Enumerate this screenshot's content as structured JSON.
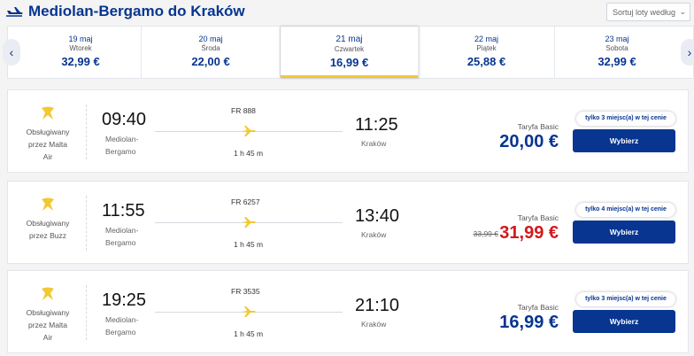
{
  "header": {
    "title": "Mediolan-Bergamo do Kraków",
    "sort_label": "Sortuj loty według",
    "icons": {
      "plane": "plane-icon",
      "sort": "chevron-down-icon"
    }
  },
  "date_strip": {
    "prev_icon": "chevron-left-icon",
    "next_icon": "chevron-right-icon",
    "days": [
      {
        "date": "19 maj",
        "weekday": "Wtorek",
        "price": "32,99 €"
      },
      {
        "date": "20 maj",
        "weekday": "Środa",
        "price": "22,00 €"
      },
      {
        "date": "21 maj",
        "weekday": "Czwartek",
        "price": "16,99 €",
        "selected": true
      },
      {
        "date": "22 maj",
        "weekday": "Piątek",
        "price": "25,88 €"
      },
      {
        "date": "23 maj",
        "weekday": "Sobota",
        "price": "32,99 €"
      }
    ]
  },
  "flights": [
    {
      "operator": [
        "Obsługiwany",
        "przez Malta",
        "Air"
      ],
      "departure_time": "09:40",
      "departure_city": [
        "Mediolan-",
        "Bergamo"
      ],
      "flight_number": "FR 888",
      "duration": "1 h 45 m",
      "arrival_time": "11:25",
      "arrival_city": "Kraków",
      "fare": "Taryfa Basic",
      "old_price": "",
      "price": "20,00 €",
      "seats": "tylko 3 miejsc(a) w tej cenie",
      "button": "Wybierz"
    },
    {
      "operator": [
        "Obsługiwany",
        "przez Buzz"
      ],
      "departure_time": "11:55",
      "departure_city": [
        "Mediolan-",
        "Bergamo"
      ],
      "flight_number": "FR 6257",
      "duration": "1 h 45 m",
      "arrival_time": "13:40",
      "arrival_city": "Kraków",
      "fare": "Taryfa Basic",
      "old_price": "33,99 €",
      "price": "31,99 €",
      "seats": "tylko 4 miejsc(a) w tej cenie",
      "button": "Wybierz"
    },
    {
      "operator": [
        "Obsługiwany",
        "przez Malta",
        "Air"
      ],
      "departure_time": "19:25",
      "departure_city": [
        "Mediolan-",
        "Bergamo"
      ],
      "flight_number": "FR 3535",
      "duration": "1 h 45 m",
      "arrival_time": "21:10",
      "arrival_city": "Kraków",
      "fare": "Taryfa Basic",
      "old_price": "",
      "price": "16,99 €",
      "seats": "tylko 3 miejsc(a) w tej cenie",
      "button": "Wybierz"
    }
  ],
  "colors": {
    "brand_blue": "#073590",
    "accent_yellow": "#f1c933",
    "sale_red": "#d3191c"
  }
}
